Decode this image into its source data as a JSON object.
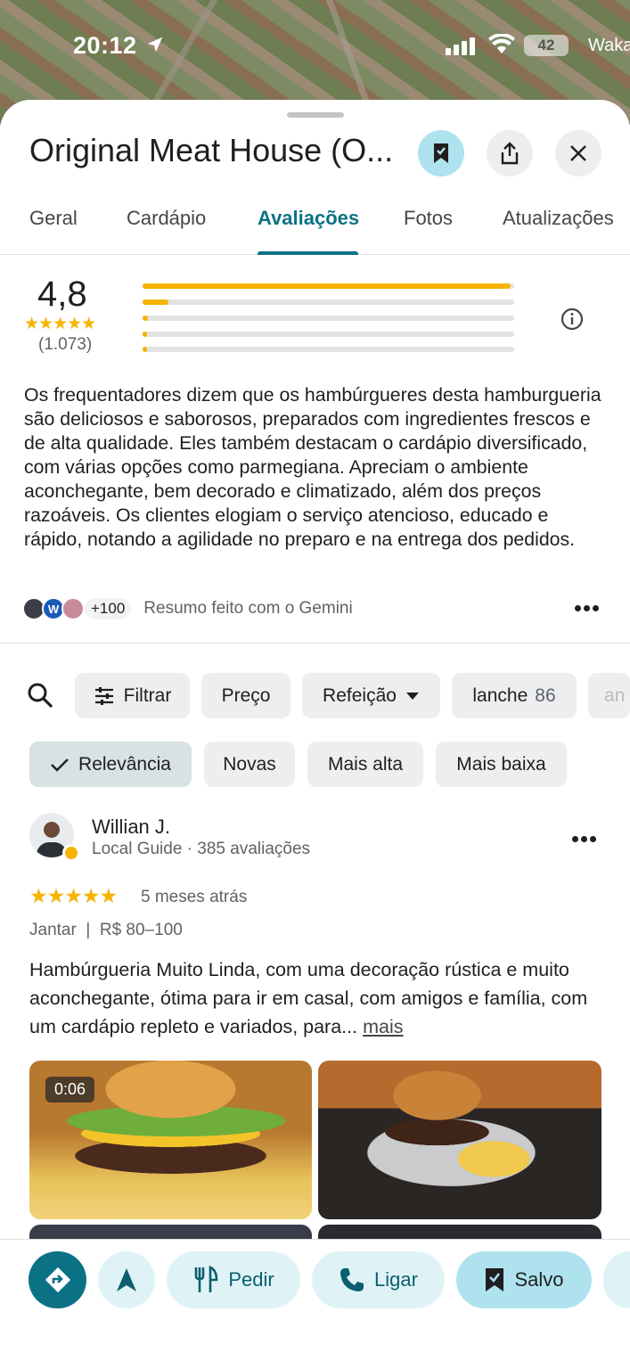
{
  "status": {
    "time": "20:12",
    "battery": "42",
    "carrier": "Waka"
  },
  "place": {
    "title": "Original Meat House (O..."
  },
  "tabs": [
    {
      "label": "Geral"
    },
    {
      "label": "Cardápio"
    },
    {
      "label": "Avaliações"
    },
    {
      "label": "Fotos"
    },
    {
      "label": "Atualizações"
    }
  ],
  "rating": {
    "score": "4,8",
    "stars": "★★★★★",
    "count": "(1.073)",
    "distribution": [
      0.99,
      0.07,
      0.015,
      0.01,
      0.01
    ]
  },
  "summary": {
    "text": "Os frequentadores dizem que os hambúrgueres desta hamburgueria são deliciosos e saborosos, preparados com ingredientes frescos e de alta qualidade. Eles também destacam o cardápio diversificado, com várias opções como parmegiana. Apreciam o ambiente aconchegante, bem decorado e climatizado, além dos preços razoáveis. Os clientes elogiam o serviço atencioso, educado e rápido, notando a agilidade no preparo e na entrega dos pedidos.",
    "avatar_letter": "W",
    "more_count": "+100",
    "gemini_label": "Resumo feito com o Gemini"
  },
  "filters": {
    "filter_label": "Filtrar",
    "price_label": "Preço",
    "meal_label": "Refeição",
    "lanche_label": "lanche",
    "lanche_count": "86",
    "next_label": "an"
  },
  "sort": [
    {
      "label": "Relevância"
    },
    {
      "label": "Novas"
    },
    {
      "label": "Mais alta"
    },
    {
      "label": "Mais baixa"
    }
  ],
  "review": {
    "name": "Willian J.",
    "meta": "Local Guide · 385 avaliações",
    "stars": "★★★★★",
    "ago": "5 meses atrás",
    "tags": "Jantar  |  R$ 80–100",
    "text": "Hambúrgueria Muito Linda, com uma decoração rústica e muito aconchegante, ótima para ir em casal, com amigos e família, com um cardápio repleto e variados, para...",
    "more": "mais",
    "video_duration": "0:06"
  },
  "actions": {
    "order": "Pedir",
    "call": "Ligar",
    "saved": "Salvo"
  },
  "colors": {
    "accent": "#0b7285",
    "star": "#f6b400",
    "saved_bg": "#aee2ee"
  }
}
